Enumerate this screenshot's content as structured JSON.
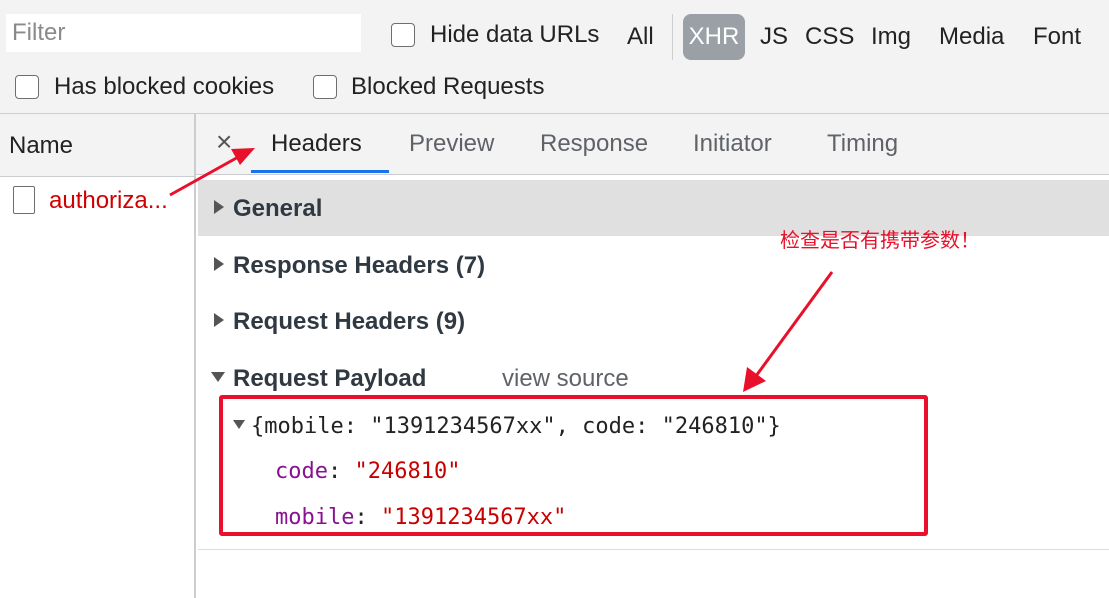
{
  "filter": {
    "placeholder": "Filter"
  },
  "checkboxes": {
    "hide_data_urls": "Hide data URLs",
    "has_blocked_cookies": "Has blocked cookies",
    "blocked_requests": "Blocked Requests"
  },
  "types": {
    "all": "All",
    "xhr": "XHR",
    "js": "JS",
    "css": "CSS",
    "img": "Img",
    "media": "Media",
    "font": "Font"
  },
  "selected_type": "XHR",
  "list": {
    "header": "Name",
    "request": "authoriza..."
  },
  "tabs": {
    "close": "×",
    "headers": "Headers",
    "preview": "Preview",
    "response": "Response",
    "initiator": "Initiator",
    "timing": "Timing"
  },
  "sections": {
    "general": "General",
    "response_headers": "Response Headers (7)",
    "request_headers": "Request Headers (9)",
    "request_payload": "Request Payload",
    "view_source": "view source"
  },
  "payload": {
    "summary": "{mobile: \"1391234567xx\", code: \"246810\"}",
    "code_key": "code",
    "code_value": "\"246810\"",
    "mobile_key": "mobile",
    "mobile_value": "\"1391234567xx\""
  },
  "annotation": "检查是否有携带参数！",
  "colors": {
    "accent_red": "#e8102a",
    "tab_underline": "#1a73e8",
    "key_purple": "#881391",
    "string_red": "#c80000"
  }
}
